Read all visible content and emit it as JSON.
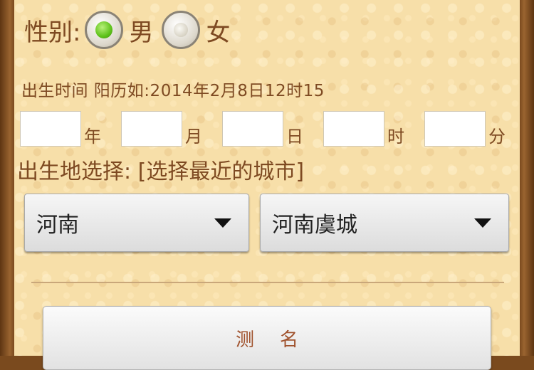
{
  "gender": {
    "label": "性别:",
    "options": [
      {
        "label": "男",
        "selected": true
      },
      {
        "label": "女",
        "selected": false
      }
    ]
  },
  "birth_time": {
    "label": "出生时间 阳历如:2014年2月8日12时15"
  },
  "date_fields": [
    {
      "unit": "年",
      "value": ""
    },
    {
      "unit": "月",
      "value": ""
    },
    {
      "unit": "日",
      "value": ""
    },
    {
      "unit": "时",
      "value": ""
    },
    {
      "unit": "分",
      "value": ""
    }
  ],
  "birthplace": {
    "label": "出生地选择: [选择最近的城市]",
    "province": "河南",
    "city": "河南虞城"
  },
  "submit": {
    "label": "测名"
  },
  "colors": {
    "text_brown": "#7e4a22",
    "panel_bg": "#f7dfa9",
    "frame": "#7a4a1e",
    "radio_selected": "#5ec21a",
    "submit_text": "#a0522d"
  }
}
